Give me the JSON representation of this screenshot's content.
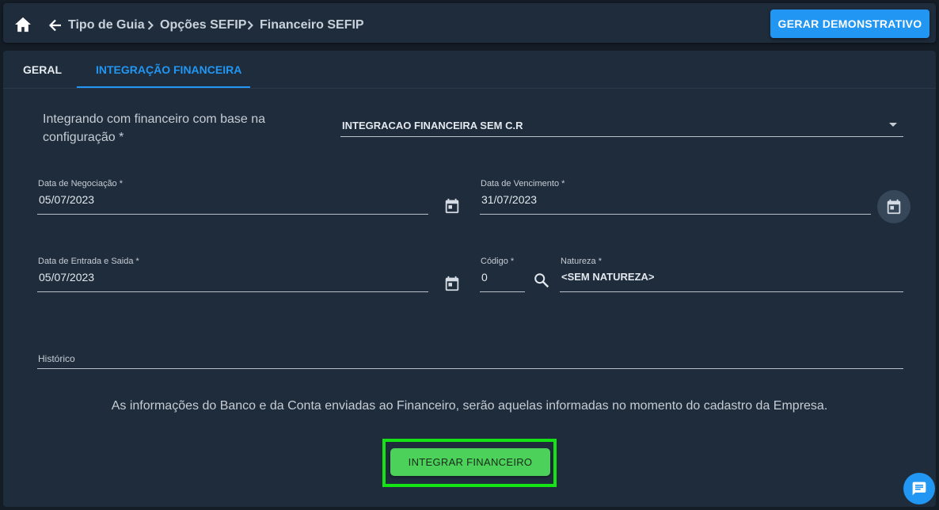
{
  "header": {
    "breadcrumbs": [
      "Tipo de Guia",
      "Opções SEFIP",
      "Financeiro SEFIP"
    ],
    "gerar_label": "GERAR DEMONSTRATIVO"
  },
  "tabs": {
    "geral": "GERAL",
    "integracao": "INTEGRAÇÃO FINANCEIRA"
  },
  "form": {
    "config_label": "Integrando com financeiro com base na configuração *",
    "config_value": "INTEGRACAO FINANCEIRA SEM C.R",
    "data_negociacao": {
      "label": "Data de Negociação *",
      "value": "05/07/2023"
    },
    "data_vencimento": {
      "label": "Data de Vencimento *",
      "value": "31/07/2023"
    },
    "data_entrada_saida": {
      "label": "Data de Entrada e Saida *",
      "value": "05/07/2023"
    },
    "codigo": {
      "label": "Código *",
      "value": "0"
    },
    "natureza": {
      "label": "Natureza *",
      "value": "<SEM NATUREZA>"
    },
    "historico": {
      "label": "Histórico",
      "value": ""
    }
  },
  "info_text": "As informações do Banco e da Conta enviadas ao Financeiro, serão aquelas informadas no momento do cadastro da Empresa.",
  "integrar_label": "INTEGRAR FINANCEIRO",
  "colors": {
    "accent": "#2196f3",
    "success": "#4cd25a",
    "highlight": "#16e316",
    "panel": "#1f2c3c",
    "background": "#141c26"
  },
  "icons": [
    "home-icon",
    "arrow-left-icon",
    "chevron-right-icon",
    "calendar-icon",
    "search-icon",
    "chat-icon",
    "dropdown-caret-icon"
  ]
}
